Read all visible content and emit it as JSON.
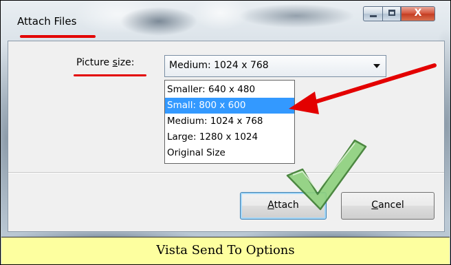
{
  "window": {
    "title": "Attach Files",
    "controls": {
      "minimize_icon": "minimize-icon",
      "maximize_icon": "maximize-icon",
      "close_icon": "close-icon",
      "close_glyph": "X"
    }
  },
  "form": {
    "label_prefix": "Picture ",
    "label_mnemonic": "s",
    "label_suffix": "ize:",
    "selected_value": "Medium: 1024 x 768",
    "options": [
      "Smaller: 640 x 480",
      "Small: 800 x 600",
      "Medium: 1024 x 768",
      "Large: 1280 x 1024",
      "Original Size"
    ],
    "highlighted_option": "Small: 800 x 600"
  },
  "buttons": {
    "attach_mnemonic": "A",
    "attach_rest": "ttach",
    "cancel_mnemonic": "C",
    "cancel_rest": "ancel"
  },
  "caption": "Vista Send To Options",
  "annotations": {
    "highlight_color": "#e30000",
    "arrow_color": "#e30000",
    "checkmark_color": "#8fd17f",
    "icons": [
      "red-arrow-icon",
      "checkmark-icon"
    ]
  },
  "colors": {
    "selection": "#3399ff",
    "caption_background": "#fdff9f",
    "close_button": "#c43d22"
  }
}
